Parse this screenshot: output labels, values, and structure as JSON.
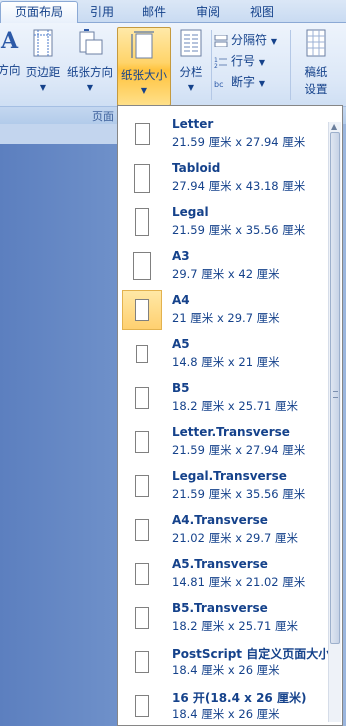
{
  "tabs": [
    "页面布局",
    "引用",
    "邮件",
    "审阅",
    "视图"
  ],
  "ribbon": {
    "orientation_label": "方向",
    "margins_label": "页边距",
    "paper_orientation_label": "纸张方向",
    "paper_size_label": "纸张大小",
    "columns_label": "分栏",
    "breaks_label": "分隔符",
    "line_numbers_label": "行号",
    "hyphenation_label": "断字",
    "draft_settings_label_1": "稿纸",
    "draft_settings_label_2": "设置",
    "group_label": "页面"
  },
  "paper_sizes": [
    {
      "name": "Letter",
      "dims": "21.59 厘米 x 27.94 厘米"
    },
    {
      "name": "Tabloid",
      "dims": "27.94 厘米 x 43.18 厘米"
    },
    {
      "name": "Legal",
      "dims": "21.59 厘米 x 35.56 厘米"
    },
    {
      "name": "A3",
      "dims": "29.7 厘米 x 42 厘米"
    },
    {
      "name": "A4",
      "dims": "21 厘米 x 29.7 厘米",
      "selected": true
    },
    {
      "name": "A5",
      "dims": "14.8 厘米 x 21 厘米"
    },
    {
      "name": "B5",
      "dims": "18.2 厘米 x 25.71 厘米"
    },
    {
      "name": "Letter.Transverse",
      "dims": "21.59 厘米 x 27.94 厘米"
    },
    {
      "name": "Legal.Transverse",
      "dims": "21.59 厘米 x 35.56 厘米"
    },
    {
      "name": "A4.Transverse",
      "dims": "21.02 厘米 x 29.7 厘米"
    },
    {
      "name": "A5.Transverse",
      "dims": "14.81 厘米 x 21.02 厘米"
    },
    {
      "name": "B5.Transverse",
      "dims": "18.2 厘米 x 25.71 厘米"
    },
    {
      "name": "PostScript 自定义页面大小",
      "dims": "18.4 厘米 x 26 厘米"
    },
    {
      "name": "16 开(18.4 x 26 厘米)",
      "dims": "18.4 厘米 x 26 厘米"
    }
  ],
  "colors": {
    "accent_text": "#15428b",
    "highlight": "#ffd46a"
  }
}
